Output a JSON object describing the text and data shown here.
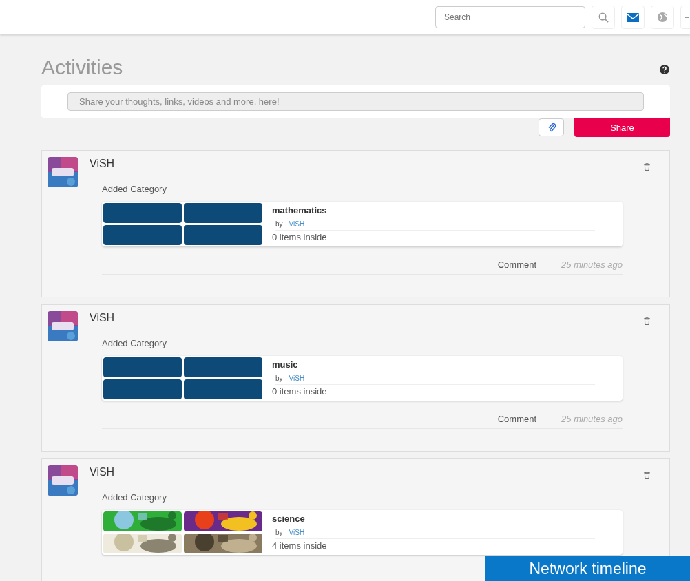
{
  "topbar": {
    "search": {
      "placeholder": "Search"
    }
  },
  "page": {
    "title": "Activities"
  },
  "composer": {
    "placeholder": "Share your thoughts, links, videos and more, here!",
    "share_button": "Share"
  },
  "activities": [
    {
      "author": "ViSH",
      "action": "Added Category",
      "category": {
        "name": "mathematics",
        "by_label": "by",
        "by": "ViSH",
        "count": "0 items inside",
        "thumbnails": {
          "kind": "blank"
        }
      },
      "comment": "Comment",
      "time": "25 minutes ago"
    },
    {
      "author": "ViSH",
      "action": "Added Category",
      "category": {
        "name": "music",
        "by_label": "by",
        "by": "ViSH",
        "count": "0 items inside",
        "thumbnails": {
          "kind": "blank"
        }
      },
      "comment": "Comment",
      "time": "25 minutes ago"
    },
    {
      "author": "ViSH",
      "action": "Added Category",
      "category": {
        "name": "science",
        "by_label": "by",
        "by": "ViSH",
        "count": "4 items inside"
      }
    }
  ],
  "banner": "Network timeline"
}
